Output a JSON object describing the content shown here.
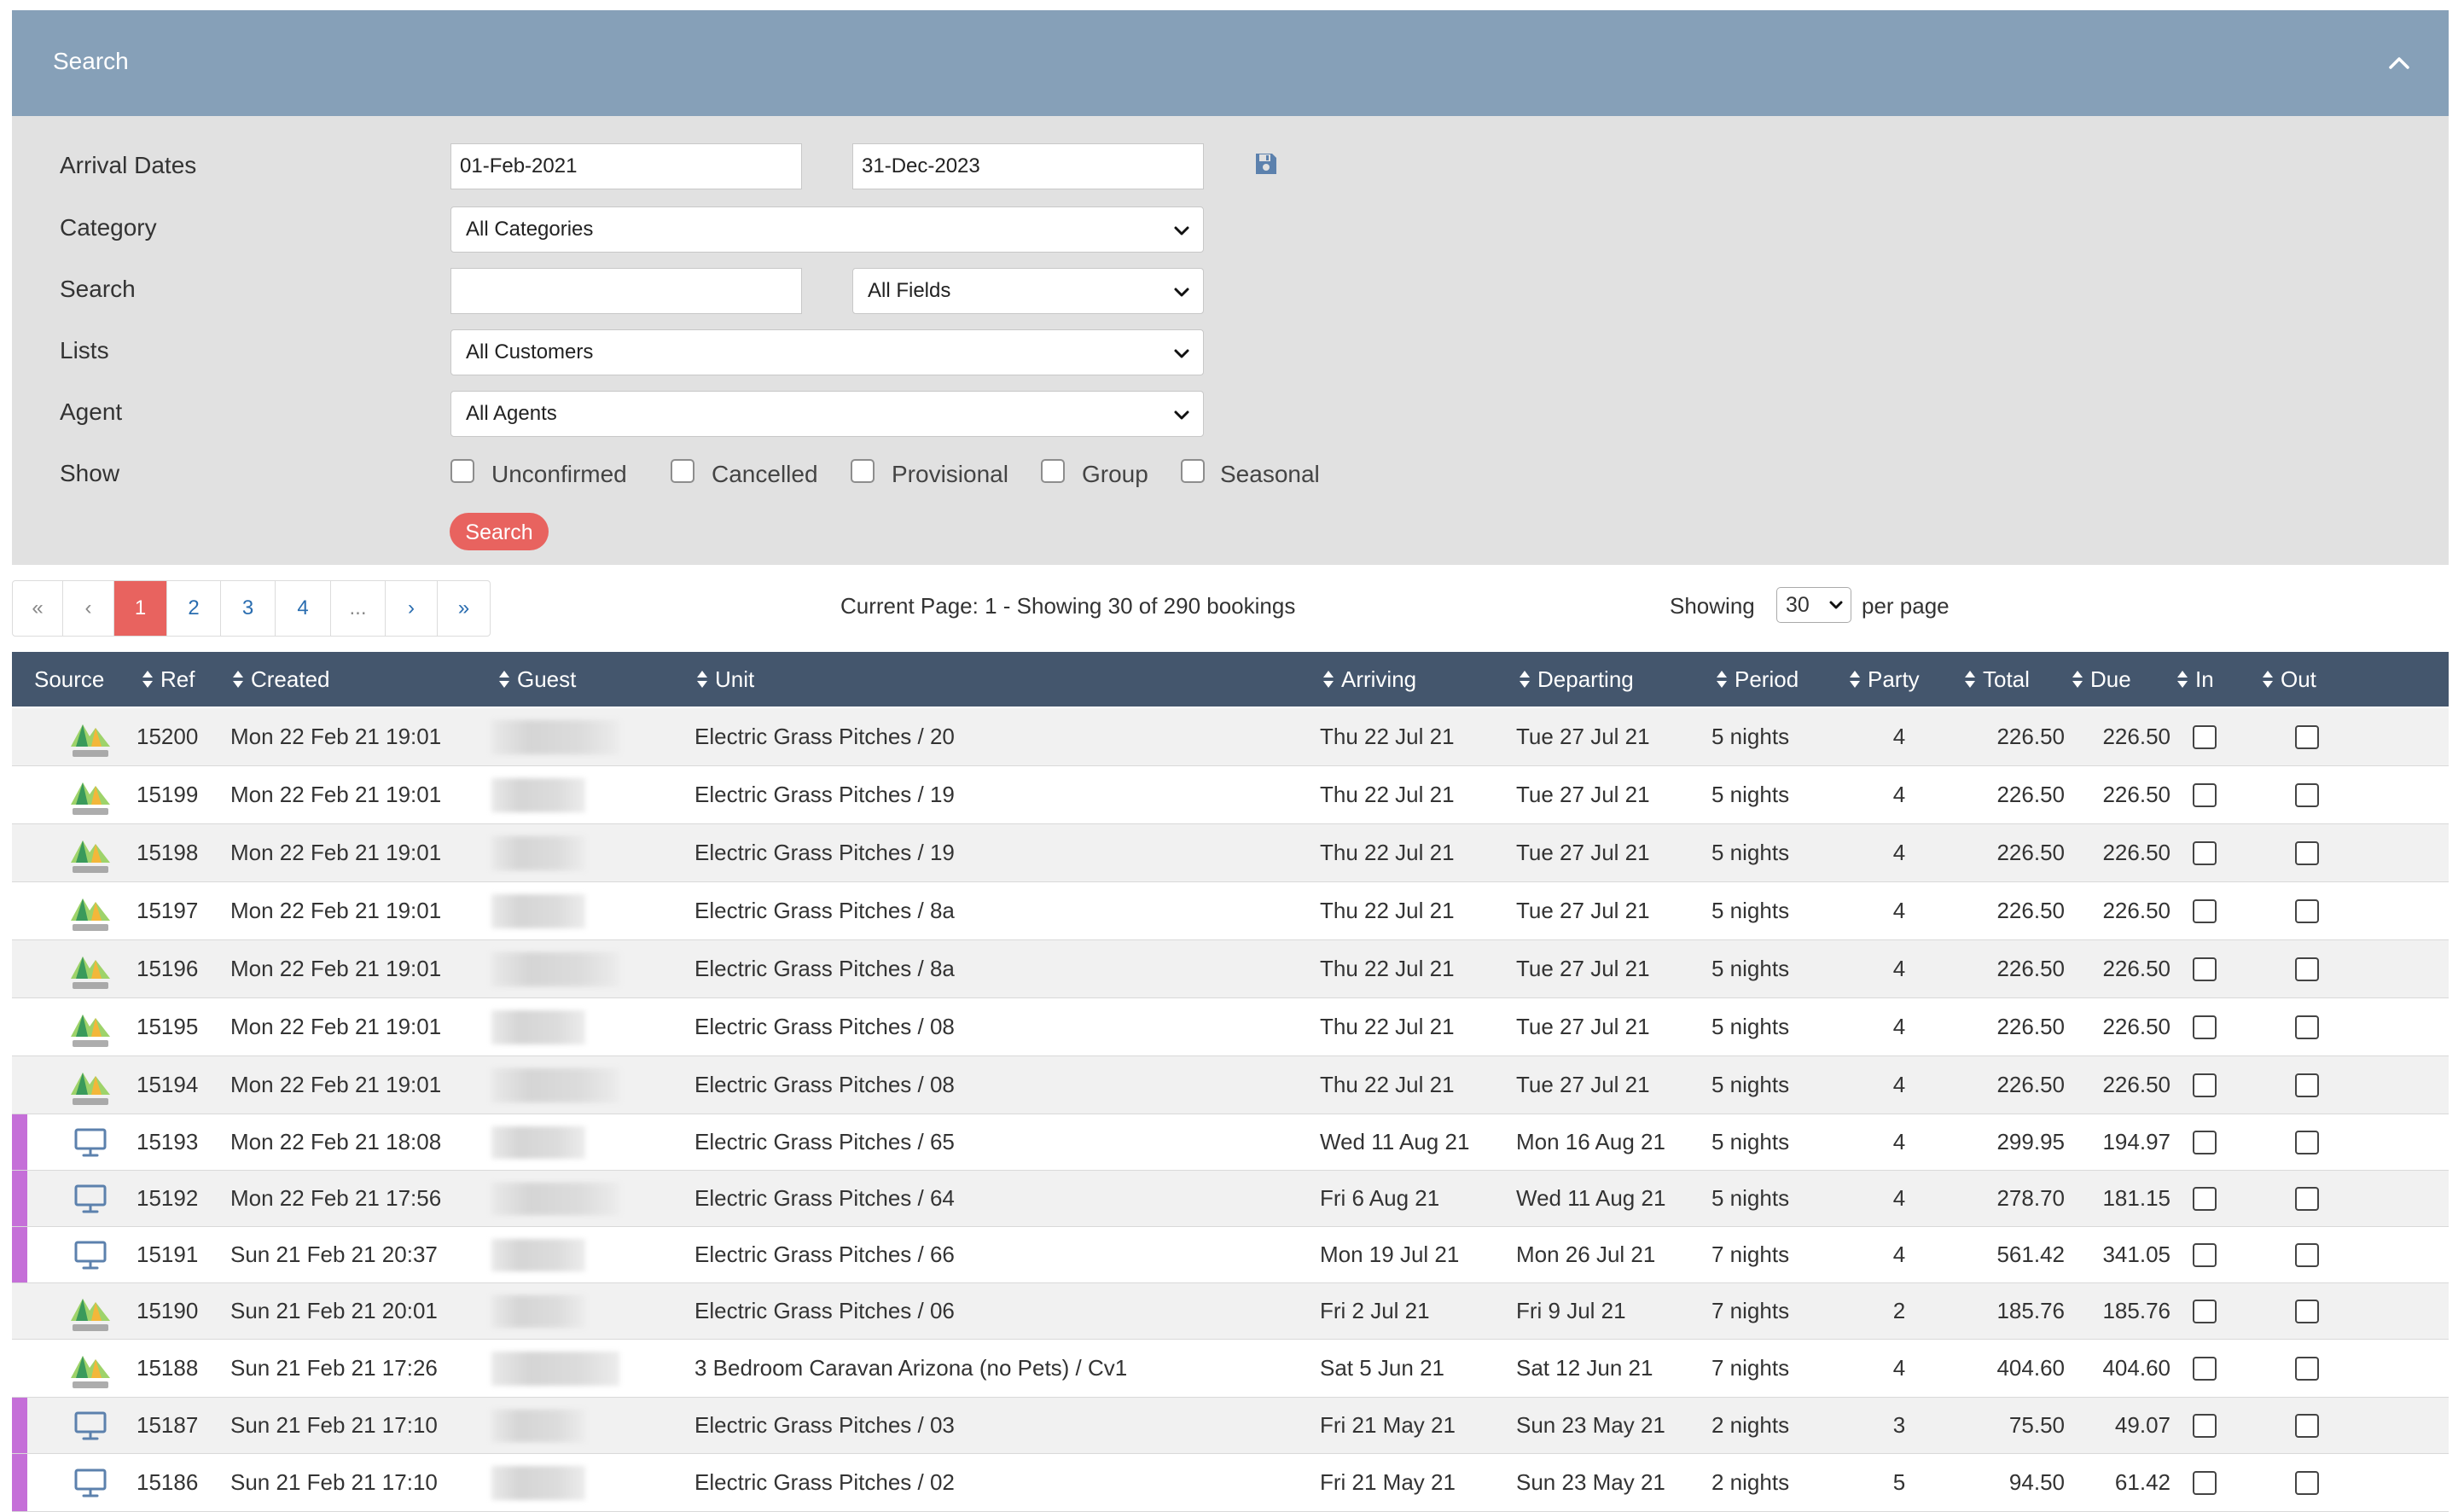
{
  "search_panel": {
    "title": "Search",
    "arrival_label": "Arrival Dates",
    "arrival_from": "01-Feb-2021",
    "arrival_to": "31-Dec-2023",
    "category_label": "Category",
    "category_value": "All Categories",
    "search_label": "Search",
    "search_value": "",
    "search_field_value": "All Fields",
    "lists_label": "Lists",
    "lists_value": "All Customers",
    "agent_label": "Agent",
    "agent_value": "All Agents",
    "show_label": "Show",
    "show_options": [
      "Unconfirmed",
      "Cancelled",
      "Provisional",
      "Group",
      "Seasonal"
    ],
    "search_button": "Search"
  },
  "pagination": {
    "first": "«",
    "prev": "‹",
    "pages": [
      "1",
      "2",
      "3",
      "4"
    ],
    "ellipsis": "...",
    "next": "›",
    "last": "»",
    "current_page": 1,
    "info": "Current Page: 1 - Showing 30 of 290 bookings",
    "showing_label": "Showing",
    "per_page_value": "30",
    "per_page_label": "per page"
  },
  "table": {
    "columns": {
      "source": "Source",
      "ref": "Ref",
      "created": "Created",
      "guest": "Guest",
      "unit": "Unit",
      "arriving": "Arriving",
      "departing": "Departing",
      "period": "Period",
      "party": "Party",
      "total": "Total",
      "due": "Due",
      "in": "In",
      "out": "Out"
    },
    "rows": [
      {
        "source": "pitchup-logo",
        "ref": "15200",
        "created": "Mon 22 Feb 21 19:01",
        "unit": "Electric Grass Pitches / 20",
        "arriving": "Thu 22 Jul 21",
        "departing": "Tue 27 Jul 21",
        "period": "5 nights",
        "party": "4",
        "total": "226.50",
        "due": "226.50"
      },
      {
        "source": "pitchup-logo",
        "ref": "15199",
        "created": "Mon 22 Feb 21 19:01",
        "unit": "Electric Grass Pitches / 19",
        "arriving": "Thu 22 Jul 21",
        "departing": "Tue 27 Jul 21",
        "period": "5 nights",
        "party": "4",
        "total": "226.50",
        "due": "226.50"
      },
      {
        "source": "pitchup-logo",
        "ref": "15198",
        "created": "Mon 22 Feb 21 19:01",
        "unit": "Electric Grass Pitches / 19",
        "arriving": "Thu 22 Jul 21",
        "departing": "Tue 27 Jul 21",
        "period": "5 nights",
        "party": "4",
        "total": "226.50",
        "due": "226.50"
      },
      {
        "source": "pitchup-logo",
        "ref": "15197",
        "created": "Mon 22 Feb 21 19:01",
        "unit": "Electric Grass Pitches / 8a",
        "arriving": "Thu 22 Jul 21",
        "departing": "Tue 27 Jul 21",
        "period": "5 nights",
        "party": "4",
        "total": "226.50",
        "due": "226.50"
      },
      {
        "source": "pitchup-logo",
        "ref": "15196",
        "created": "Mon 22 Feb 21 19:01",
        "unit": "Electric Grass Pitches / 8a",
        "arriving": "Thu 22 Jul 21",
        "departing": "Tue 27 Jul 21",
        "period": "5 nights",
        "party": "4",
        "total": "226.50",
        "due": "226.50"
      },
      {
        "source": "pitchup-logo",
        "ref": "15195",
        "created": "Mon 22 Feb 21 19:01",
        "unit": "Electric Grass Pitches / 08",
        "arriving": "Thu 22 Jul 21",
        "departing": "Tue 27 Jul 21",
        "period": "5 nights",
        "party": "4",
        "total": "226.50",
        "due": "226.50"
      },
      {
        "source": "pitchup-logo",
        "ref": "15194",
        "created": "Mon 22 Feb 21 19:01",
        "unit": "Electric Grass Pitches / 08",
        "arriving": "Thu 22 Jul 21",
        "departing": "Tue 27 Jul 21",
        "period": "5 nights",
        "party": "4",
        "total": "226.50",
        "due": "226.50"
      },
      {
        "source": "desktop-icon",
        "ref": "15193",
        "created": "Mon 22 Feb 21 18:08",
        "unit": "Electric Grass Pitches / 65",
        "arriving": "Wed 11 Aug 21",
        "departing": "Mon 16 Aug 21",
        "period": "5 nights",
        "party": "4",
        "total": "299.95",
        "due": "194.97"
      },
      {
        "source": "desktop-icon",
        "ref": "15192",
        "created": "Mon 22 Feb 21 17:56",
        "unit": "Electric Grass Pitches / 64",
        "arriving": "Fri 6 Aug 21",
        "departing": "Wed 11 Aug 21",
        "period": "5 nights",
        "party": "4",
        "total": "278.70",
        "due": "181.15"
      },
      {
        "source": "desktop-icon",
        "ref": "15191",
        "created": "Sun 21 Feb 21 20:37",
        "unit": "Electric Grass Pitches / 66",
        "arriving": "Mon 19 Jul 21",
        "departing": "Mon 26 Jul 21",
        "period": "7 nights",
        "party": "4",
        "total": "561.42",
        "due": "341.05"
      },
      {
        "source": "pitchup-logo",
        "ref": "15190",
        "created": "Sun 21 Feb 21 20:01",
        "unit": "Electric Grass Pitches / 06",
        "arriving": "Fri 2 Jul 21",
        "departing": "Fri 9 Jul 21",
        "period": "7 nights",
        "party": "2",
        "total": "185.76",
        "due": "185.76"
      },
      {
        "source": "pitchup-logo",
        "ref": "15188",
        "created": "Sun 21 Feb 21 17:26",
        "unit": "3 Bedroom Caravan Arizona (no Pets) / Cv1",
        "arriving": "Sat 5 Jun 21",
        "departing": "Sat 12 Jun 21",
        "period": "7 nights",
        "party": "4",
        "total": "404.60",
        "due": "404.60"
      },
      {
        "source": "desktop-icon",
        "ref": "15187",
        "created": "Sun 21 Feb 21 17:10",
        "unit": "Electric Grass Pitches / 03",
        "arriving": "Fri 21 May 21",
        "departing": "Sun 23 May 21",
        "period": "2 nights",
        "party": "3",
        "total": "75.50",
        "due": "49.07"
      },
      {
        "source": "desktop-icon",
        "ref": "15186",
        "created": "Sun 21 Feb 21 17:10",
        "unit": "Electric Grass Pitches / 02",
        "arriving": "Fri 21 May 21",
        "departing": "Sun 23 May 21",
        "period": "2 nights",
        "party": "5",
        "total": "94.50",
        "due": "61.42"
      }
    ]
  },
  "colors": {
    "panel_header": "#86a0b8",
    "table_header": "#44566d",
    "accent": "#e8635f",
    "web_source_marker": "#c56fd8"
  }
}
